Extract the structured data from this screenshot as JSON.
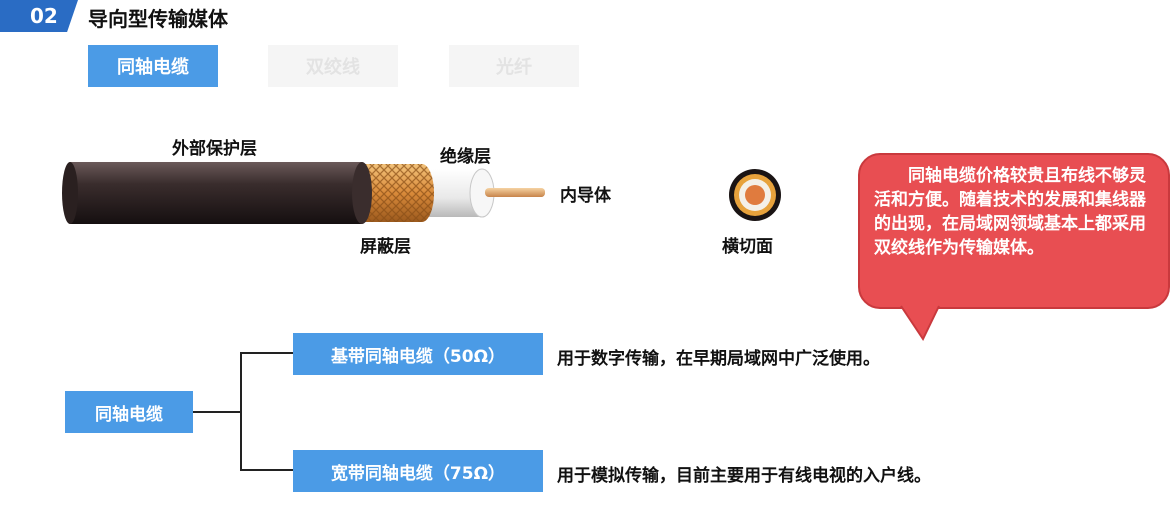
{
  "header": {
    "number": "02",
    "title": "导向型传输媒体"
  },
  "tabs": [
    {
      "label": "同轴电缆",
      "active": true
    },
    {
      "label": "双绞线",
      "active": false
    },
    {
      "label": "光纤",
      "active": false
    }
  ],
  "cable": {
    "outer_label": "外部保护层",
    "insulation_label": "绝缘层",
    "conductor_label": "内导体",
    "shield_label": "屏蔽层",
    "cross_section_label": "横切面"
  },
  "callout": {
    "text": "同轴电缆价格较贵且布线不够灵活和方便。随着技术的发展和集线器的出现，在局域网领域基本上都采用双绞线作为传输媒体。"
  },
  "tree": {
    "root": "同轴电缆",
    "branches": [
      {
        "label": "基带同轴电缆（50Ω）",
        "description": "用于数字传输，在早期局域网中广泛使用。"
      },
      {
        "label": "宽带同轴电缆（75Ω）",
        "description": "用于模拟传输，目前主要用于有线电视的入户线。"
      }
    ]
  },
  "colors": {
    "accent_blue": "#4b9be6",
    "badge_blue": "#2a6cc4",
    "callout_red": "#e84e52",
    "copper": "#d98a3a"
  }
}
